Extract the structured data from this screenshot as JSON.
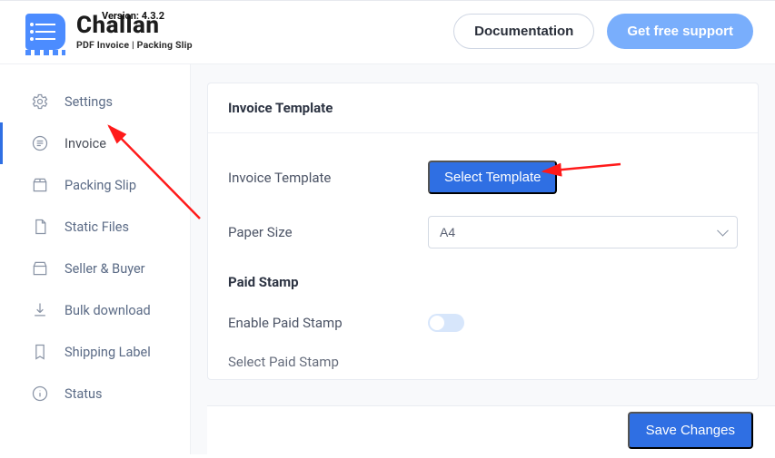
{
  "header": {
    "version": "Version: 4.3.2",
    "brand_name": "Challan",
    "brand_tagline": "PDF Invoice | Packing Slip",
    "doc_button": "Documentation",
    "support_button": "Get free support"
  },
  "sidebar": {
    "items": [
      {
        "label": "Settings"
      },
      {
        "label": "Invoice"
      },
      {
        "label": "Packing Slip"
      },
      {
        "label": "Static Files"
      },
      {
        "label": "Seller & Buyer"
      },
      {
        "label": "Bulk download"
      },
      {
        "label": "Shipping Label"
      },
      {
        "label": "Status"
      }
    ]
  },
  "panel": {
    "section_title": "Invoice Template",
    "row_template_label": "Invoice Template",
    "select_template_button": "Select Template",
    "row_paper_label": "Paper Size",
    "paper_value": "A4",
    "subsection_title": "Paid Stamp",
    "row_enable_label": "Enable Paid Stamp",
    "row_select_stamp_label": "Select Paid Stamp"
  },
  "footer": {
    "save_button": "Save Changes"
  }
}
